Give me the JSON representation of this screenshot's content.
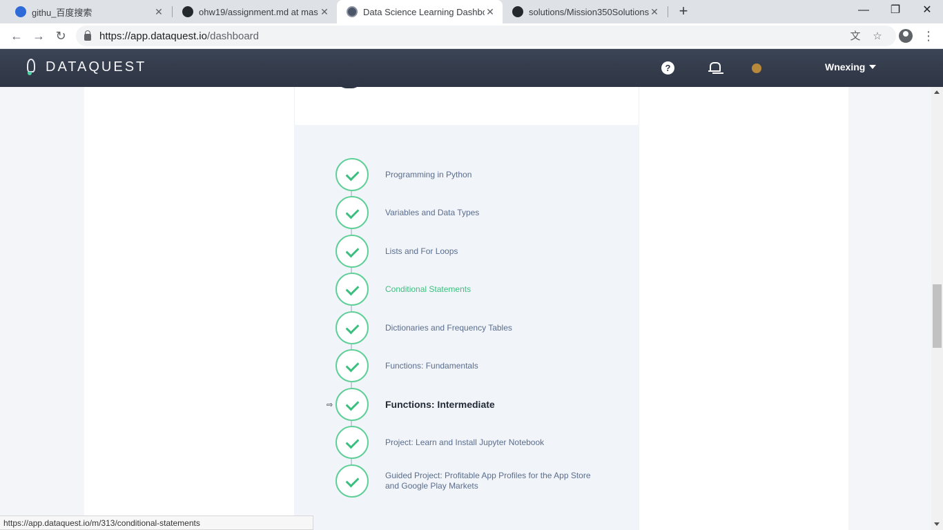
{
  "browser": {
    "tabs": [
      {
        "title": "githu_百度搜索",
        "favicon": "baidu-icon",
        "active": false
      },
      {
        "title": "ohw19/assignment.md at mas",
        "favicon": "github-icon",
        "active": false
      },
      {
        "title": "Data Science Learning Dashbo",
        "favicon": "dataquest-icon",
        "active": true
      },
      {
        "title": "solutions/Mission350Solutions",
        "favicon": "github-icon",
        "active": false
      }
    ],
    "url_host": "https://app.dataquest.io",
    "url_path": "/dashboard",
    "status_url": "https://app.dataquest.io/m/313/conditional-statements"
  },
  "header": {
    "logo": "DATAQUEST",
    "user": "Wnexing",
    "help": "?"
  },
  "steps": [
    {
      "label": "Programming in Python",
      "state": "normal"
    },
    {
      "label": "Variables and Data Types",
      "state": "normal"
    },
    {
      "label": "Lists and For Loops",
      "state": "normal"
    },
    {
      "label": "Conditional Statements",
      "state": "highlight"
    },
    {
      "label": "Dictionaries and Frequency Tables",
      "state": "normal"
    },
    {
      "label": "Functions: Fundamentals",
      "state": "normal"
    },
    {
      "label": "Functions: Intermediate",
      "state": "current"
    },
    {
      "label": "Project: Learn and Install Jupyter Notebook",
      "state": "normal"
    },
    {
      "label": "Guided Project: Profitable App Profiles for the App Store and Google Play Markets",
      "state": "normal"
    }
  ],
  "colors": {
    "header_bg": "#2e3544",
    "check_green": "#3cbf7e",
    "step_text": "#5a6d8c",
    "status_dot": "#b8893a"
  }
}
